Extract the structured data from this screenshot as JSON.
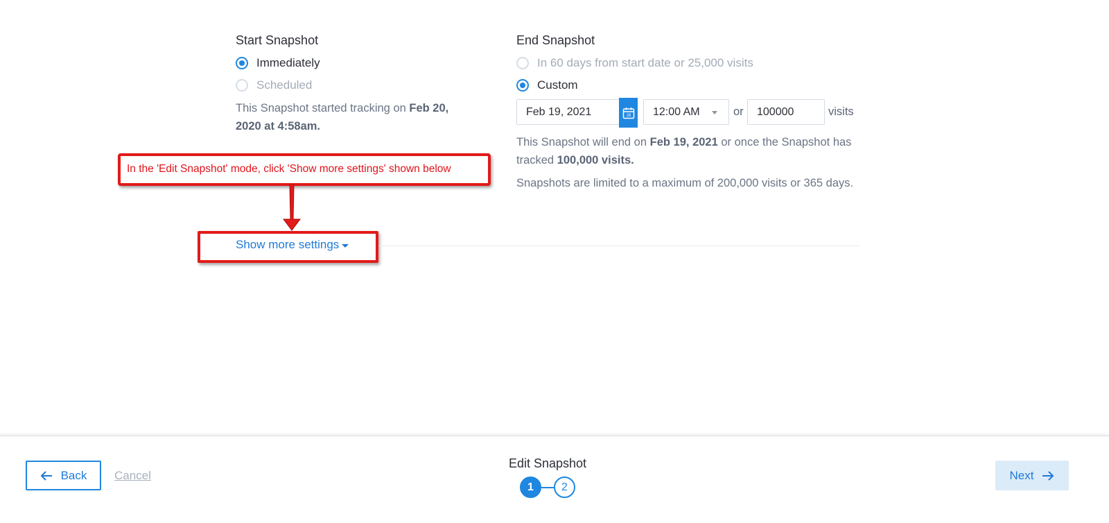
{
  "start": {
    "title": "Start Snapshot",
    "options": [
      {
        "label": "Immediately",
        "selected": true
      },
      {
        "label": "Scheduled",
        "selected": false
      }
    ],
    "info": {
      "prefix": "This Snapshot started tracking on ",
      "date_bold": "Feb 20, 2020 at 4:58am."
    }
  },
  "end": {
    "title": "End Snapshot",
    "options": [
      {
        "label": "In 60 days from start date or 25,000 visits",
        "selected": false
      },
      {
        "label": "Custom",
        "selected": true
      }
    ],
    "date_value": "Feb 19, 2021",
    "calendar_day": "28",
    "time_value": "12:00 AM",
    "or_text": "or",
    "visits_value": "100000",
    "visits_unit": "visits",
    "info": {
      "prefix": "This Snapshot will end on ",
      "date_bold": "Feb 19, 2021",
      "middle": " or once the Snapshot has tracked ",
      "visits_bold": "100,000 visits."
    },
    "limit_text": "Snapshots are limited to a maximum of 200,000 visits or 365 days."
  },
  "annotation": {
    "text": "In the 'Edit Snapshot' mode, click 'Show more settings' shown below",
    "color": "#e21a1a"
  },
  "settings_link": "Show more settings",
  "footer": {
    "back_label": "Back",
    "cancel_label": "Cancel",
    "step_title": "Edit Snapshot",
    "steps": [
      "1",
      "2"
    ],
    "current_step": 1,
    "next_label": "Next"
  },
  "colors": {
    "accent": "#1f87e0",
    "annotation": "#e21a1a"
  }
}
